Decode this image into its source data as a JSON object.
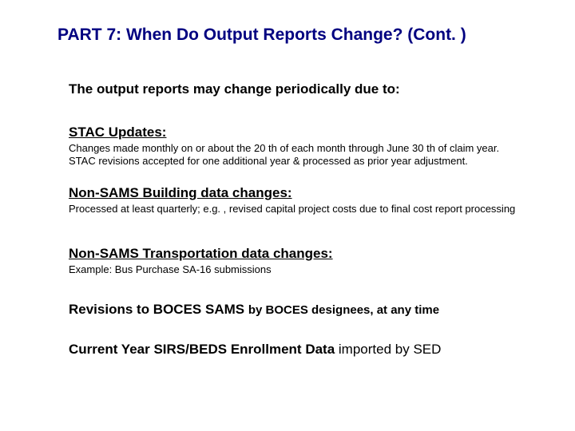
{
  "title": "PART 7: When Do Output Reports Change? (Cont. )",
  "intro": "The output reports may change periodically due to:",
  "sections": [
    {
      "heading": "STAC Updates:",
      "body": "Changes made monthly on or about the 20 th of each month through June 30 th of claim year. STAC revisions accepted for one additional year & processed as prior year adjustment."
    },
    {
      "heading": "Non-SAMS Building data changes:",
      "body": "Processed at least quarterly; e.g. , revised capital project costs due to final cost report processing"
    },
    {
      "heading": "Non-SAMS Transportation data changes:",
      "body": "Example: Bus Purchase SA-16 submissions"
    }
  ],
  "lines": [
    {
      "bold": "Revisions to BOCES SAMS ",
      "rest": "by BOCES designees, at any time"
    },
    {
      "bold": "Current Year SIRS/BEDS Enrollment Data ",
      "rest": "imported by SED"
    }
  ]
}
